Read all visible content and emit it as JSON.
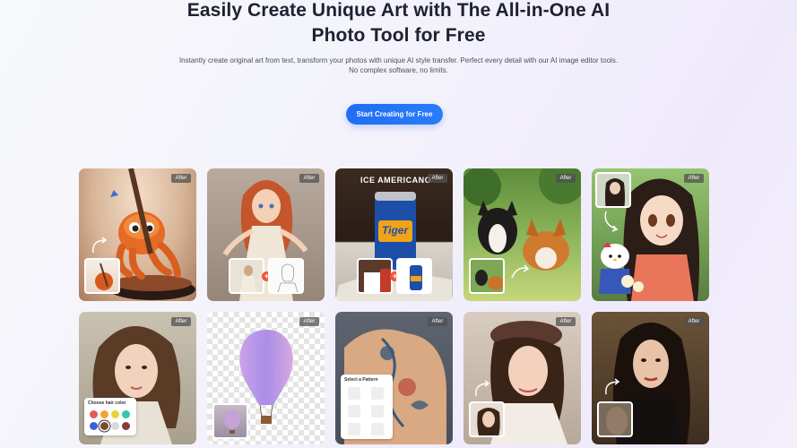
{
  "hero": {
    "title_line1": "Easily Create Unique Art with The All-in-One AI",
    "title_line2": "Photo Tool for Free",
    "subtitle_line1": "Instantly create original art from text, transform your photos with unique AI style transfer. Perfect every detail with our AI image editor tools.",
    "subtitle_line2": "No complex software, no limits.",
    "cta_label": "Start Creating for Free"
  },
  "gallery": {
    "badge_label": "After",
    "cards": [
      {
        "name": "octopus-painter"
      },
      {
        "name": "redhead-princess"
      },
      {
        "name": "tiger-beer-can"
      },
      {
        "name": "painted-dogs"
      },
      {
        "name": "anime-girl-hello-kitty"
      },
      {
        "name": "hair-color-woman"
      },
      {
        "name": "hot-air-balloon"
      },
      {
        "name": "back-tattoo"
      },
      {
        "name": "beret-woman"
      },
      {
        "name": "dark-hair-woman"
      }
    ],
    "can_text": "ICE AMERICANO",
    "can_brand": "Tiger",
    "hair_panel_title": "Choose hair color",
    "pattern_panel_title": "Select a Pattern"
  },
  "colors": {
    "accent": "#1f6ef5",
    "plus": "#f2553c"
  }
}
